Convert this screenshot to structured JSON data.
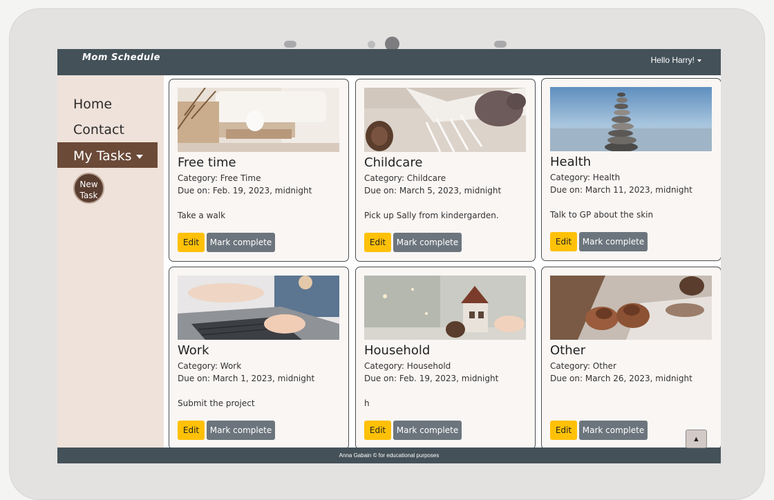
{
  "app": {
    "brand": "Mom Schedule",
    "user_greeting": "Hello Harry!"
  },
  "sidebar": {
    "items": [
      {
        "label": "Home"
      },
      {
        "label": "Contact"
      },
      {
        "label": "My Tasks"
      }
    ],
    "new_task_line1": "New",
    "new_task_line2": "Task"
  },
  "tasks": [
    {
      "title": "Free time",
      "category": "Category: Free Time",
      "due": "Due on: Feb. 19, 2023, midnight",
      "description": "Take a walk",
      "edit_label": "Edit",
      "complete_label": "Mark complete"
    },
    {
      "title": "Childcare",
      "category": "Category: Childcare",
      "due": "Due on: March 5, 2023, midnight",
      "description": "Pick up Sally from kindergarden.",
      "edit_label": "Edit",
      "complete_label": "Mark complete"
    },
    {
      "title": "Health",
      "category": "Category: Health",
      "due": "Due on: March 11, 2023, midnight",
      "description": "Talk to GP about the skin",
      "edit_label": "Edit",
      "complete_label": "Mark complete"
    },
    {
      "title": "Work",
      "category": "Category: Work",
      "due": "Due on: March 1, 2023, midnight",
      "description": "Submit the project",
      "edit_label": "Edit",
      "complete_label": "Mark complete"
    },
    {
      "title": "Household",
      "category": "Category: Household",
      "due": "Due on: Feb. 19, 2023, midnight",
      "description": "h",
      "edit_label": "Edit",
      "complete_label": "Mark complete"
    },
    {
      "title": "Other",
      "category": "Category: Other",
      "due": "Due on: March 26, 2023, midnight",
      "description": "",
      "edit_label": "Edit",
      "complete_label": "Mark complete"
    }
  ],
  "footer": {
    "text": "Anna Gabain © for educational purposes"
  },
  "scroll_top_label": "▲",
  "colors": {
    "navbar": "#445159",
    "sidebar": "#efe2da",
    "active_nav": "#6b4a38",
    "edit": "#ffc107",
    "complete": "#6c757d"
  }
}
